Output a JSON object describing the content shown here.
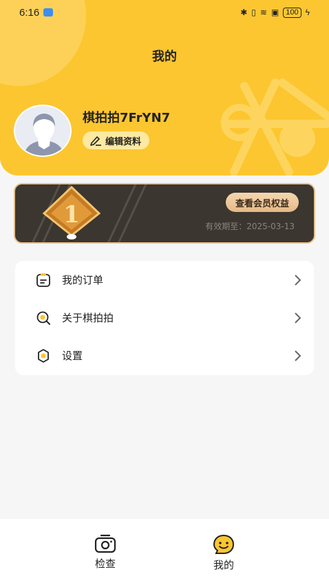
{
  "status_bar": {
    "time": "6:16",
    "battery": "100"
  },
  "header": {
    "title": "我的"
  },
  "profile": {
    "username": "棋拍拍7FrYN7",
    "edit_label": "编辑资料"
  },
  "membership": {
    "level_icon": "rank-1-badge-icon",
    "benefits_button": "查看会员权益",
    "expire_text": "有效期至：2025-03-13"
  },
  "menu": {
    "items": [
      {
        "label": "我的订单",
        "icon": "order-icon"
      },
      {
        "label": "关于棋拍拍",
        "icon": "about-icon"
      },
      {
        "label": "设置",
        "icon": "settings-icon"
      }
    ]
  },
  "bottom_nav": {
    "tabs": [
      {
        "label": "检查",
        "icon": "camera-icon"
      },
      {
        "label": "我的",
        "icon": "smile-face-icon"
      }
    ]
  },
  "colors": {
    "accent_yellow": "#fcc630",
    "vip_dark": "#3b3630",
    "vip_gold": "#e7c08c"
  }
}
